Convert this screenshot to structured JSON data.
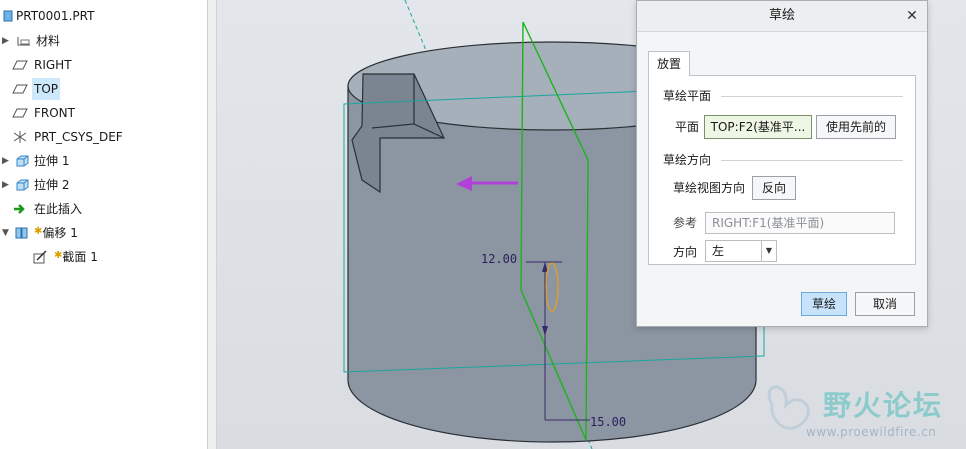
{
  "tree": {
    "root": "PRT0001.PRT",
    "items": [
      {
        "label": "材料",
        "icon": "material-icon",
        "expandable": true
      },
      {
        "label": "RIGHT",
        "icon": "datum-plane-icon",
        "expandable": false
      },
      {
        "label": "TOP",
        "icon": "datum-plane-icon",
        "expandable": false,
        "selected": true
      },
      {
        "label": "FRONT",
        "icon": "datum-plane-icon",
        "expandable": false
      },
      {
        "label": "PRT_CSYS_DEF",
        "icon": "csys-icon",
        "expandable": false
      },
      {
        "label": "拉伸 1",
        "icon": "extrude-icon",
        "expandable": true
      },
      {
        "label": "拉伸 2",
        "icon": "extrude-icon",
        "expandable": true
      },
      {
        "label": "在此插入",
        "icon": "insert-arrow-icon",
        "expandable": false
      },
      {
        "label": "偏移 1",
        "icon": "offset-icon",
        "expandable": true,
        "expanded": true,
        "new": true
      },
      {
        "label": "截面 1",
        "icon": "section-sketch-icon",
        "expandable": false,
        "new": true,
        "child": true
      }
    ]
  },
  "viewport": {
    "dim_left": "12.00",
    "dim_bottom": "15.00",
    "watermark_name": "野火论坛",
    "watermark_url": "www.proewildfire.cn"
  },
  "dialog": {
    "title": "草绘",
    "tab": "放置",
    "group_plane": "草绘平面",
    "plane_label": "平面",
    "plane_value": "TOP:F2(基准平...",
    "use_prev_button": "使用先前的",
    "group_orient": "草绘方向",
    "view_dir_label": "草绘视图方向",
    "flip_button": "反向",
    "ref_label": "参考",
    "ref_value": "RIGHT:F1(基准平面)",
    "dir_label": "方向",
    "dir_value": "左",
    "ok_button": "草绘",
    "cancel_button": "取消"
  },
  "colors": {
    "selection": "#cde8fb",
    "model": "#8d97a3",
    "datum_green": "#1db31d",
    "datum_teal": "#1aa5a0",
    "purple_arrow": "#b040d8",
    "red_arrow": "#e8231a",
    "ok_button": "#c6e3fb"
  }
}
